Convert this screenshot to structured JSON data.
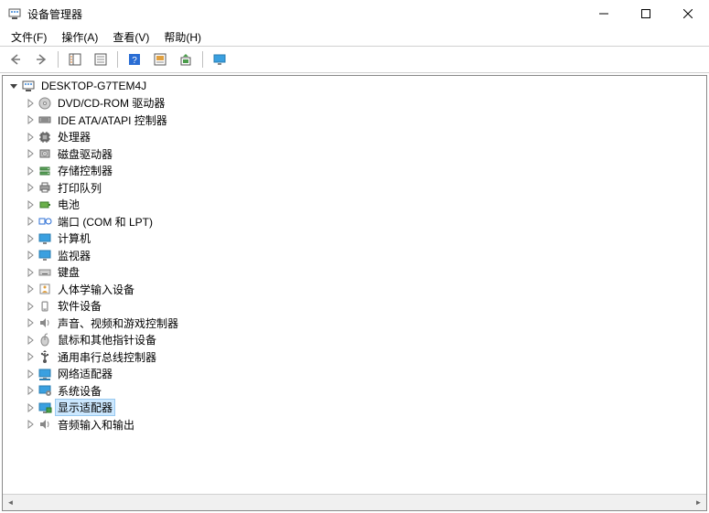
{
  "window": {
    "title": "设备管理器"
  },
  "menu": {
    "file": "文件(F)",
    "action": "操作(A)",
    "view": "查看(V)",
    "help": "帮助(H)"
  },
  "tree": {
    "root": "DESKTOP-G7TEM4J",
    "items": [
      {
        "label": "DVD/CD-ROM 驱动器",
        "icon": "disc"
      },
      {
        "label": "IDE ATA/ATAPI 控制器",
        "icon": "ide"
      },
      {
        "label": "处理器",
        "icon": "cpu"
      },
      {
        "label": "磁盘驱动器",
        "icon": "disk"
      },
      {
        "label": "存储控制器",
        "icon": "storage"
      },
      {
        "label": "打印队列",
        "icon": "printer"
      },
      {
        "label": "电池",
        "icon": "battery"
      },
      {
        "label": "端口 (COM 和 LPT)",
        "icon": "port"
      },
      {
        "label": "计算机",
        "icon": "monitor"
      },
      {
        "label": "监视器",
        "icon": "monitor"
      },
      {
        "label": "键盘",
        "icon": "keyboard"
      },
      {
        "label": "人体学输入设备",
        "icon": "hid"
      },
      {
        "label": "软件设备",
        "icon": "software"
      },
      {
        "label": "声音、视频和游戏控制器",
        "icon": "speaker"
      },
      {
        "label": "鼠标和其他指针设备",
        "icon": "mouse"
      },
      {
        "label": "通用串行总线控制器",
        "icon": "usb"
      },
      {
        "label": "网络适配器",
        "icon": "network"
      },
      {
        "label": "系统设备",
        "icon": "system"
      },
      {
        "label": "显示适配器",
        "icon": "display",
        "selected": true
      },
      {
        "label": "音频输入和输出",
        "icon": "speaker"
      }
    ]
  }
}
